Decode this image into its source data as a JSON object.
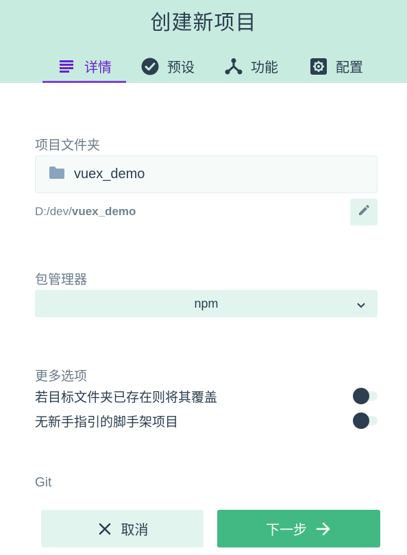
{
  "header": {
    "title": "创建新项目",
    "tabs": [
      {
        "label": "详情",
        "icon": "list-icon",
        "active": true
      },
      {
        "label": "预设",
        "icon": "check-circle-icon",
        "active": false
      },
      {
        "label": "功能",
        "icon": "fork-icon",
        "active": false
      },
      {
        "label": "配置",
        "icon": "gear-icon",
        "active": false
      }
    ]
  },
  "project_folder": {
    "label": "项目文件夹",
    "value": "vuex_demo",
    "path_prefix": "D:/dev/",
    "path_name": "vuex_demo"
  },
  "package_manager": {
    "label": "包管理器",
    "selected": "npm"
  },
  "more_options": {
    "label": "更多选项",
    "options": [
      {
        "label": "若目标文件夹已存在则将其覆盖",
        "enabled": false
      },
      {
        "label": "无新手指引的脚手架项目",
        "enabled": false
      }
    ]
  },
  "git": {
    "label": "Git"
  },
  "footer": {
    "cancel_label": "取消",
    "next_label": "下一步"
  },
  "colors": {
    "header_bg": "#c8ebe0",
    "accent_purple": "#6a1fd0",
    "primary_green": "#42b983",
    "light_green": "#e2f4ee",
    "text_dark": "#2c3e50"
  }
}
